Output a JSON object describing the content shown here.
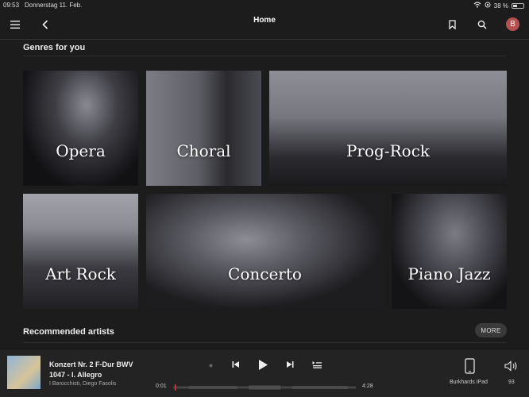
{
  "status": {
    "time": "09:53",
    "date": "Donnerstag 11. Feb.",
    "battery": "38 %"
  },
  "nav": {
    "title": "Home",
    "avatar_letter": "B"
  },
  "genres": {
    "title": "Genres for you",
    "items": [
      {
        "label": "Opera"
      },
      {
        "label": "Choral"
      },
      {
        "label": "Prog-Rock"
      },
      {
        "label": "Art Rock"
      },
      {
        "label": "Concerto"
      },
      {
        "label": "Piano Jazz"
      }
    ]
  },
  "recommended": {
    "title": "Recommended artists",
    "more_label": "MORE"
  },
  "player": {
    "track_line1": "Konzert Nr. 2 F-Dur BWV",
    "track_line2": "1047 - I. Allegro",
    "artist": "I Barocchisti, Diego Fasolis",
    "elapsed": "0:01",
    "duration": "4:28",
    "device": "Burkhards iPad",
    "volume": "93"
  }
}
